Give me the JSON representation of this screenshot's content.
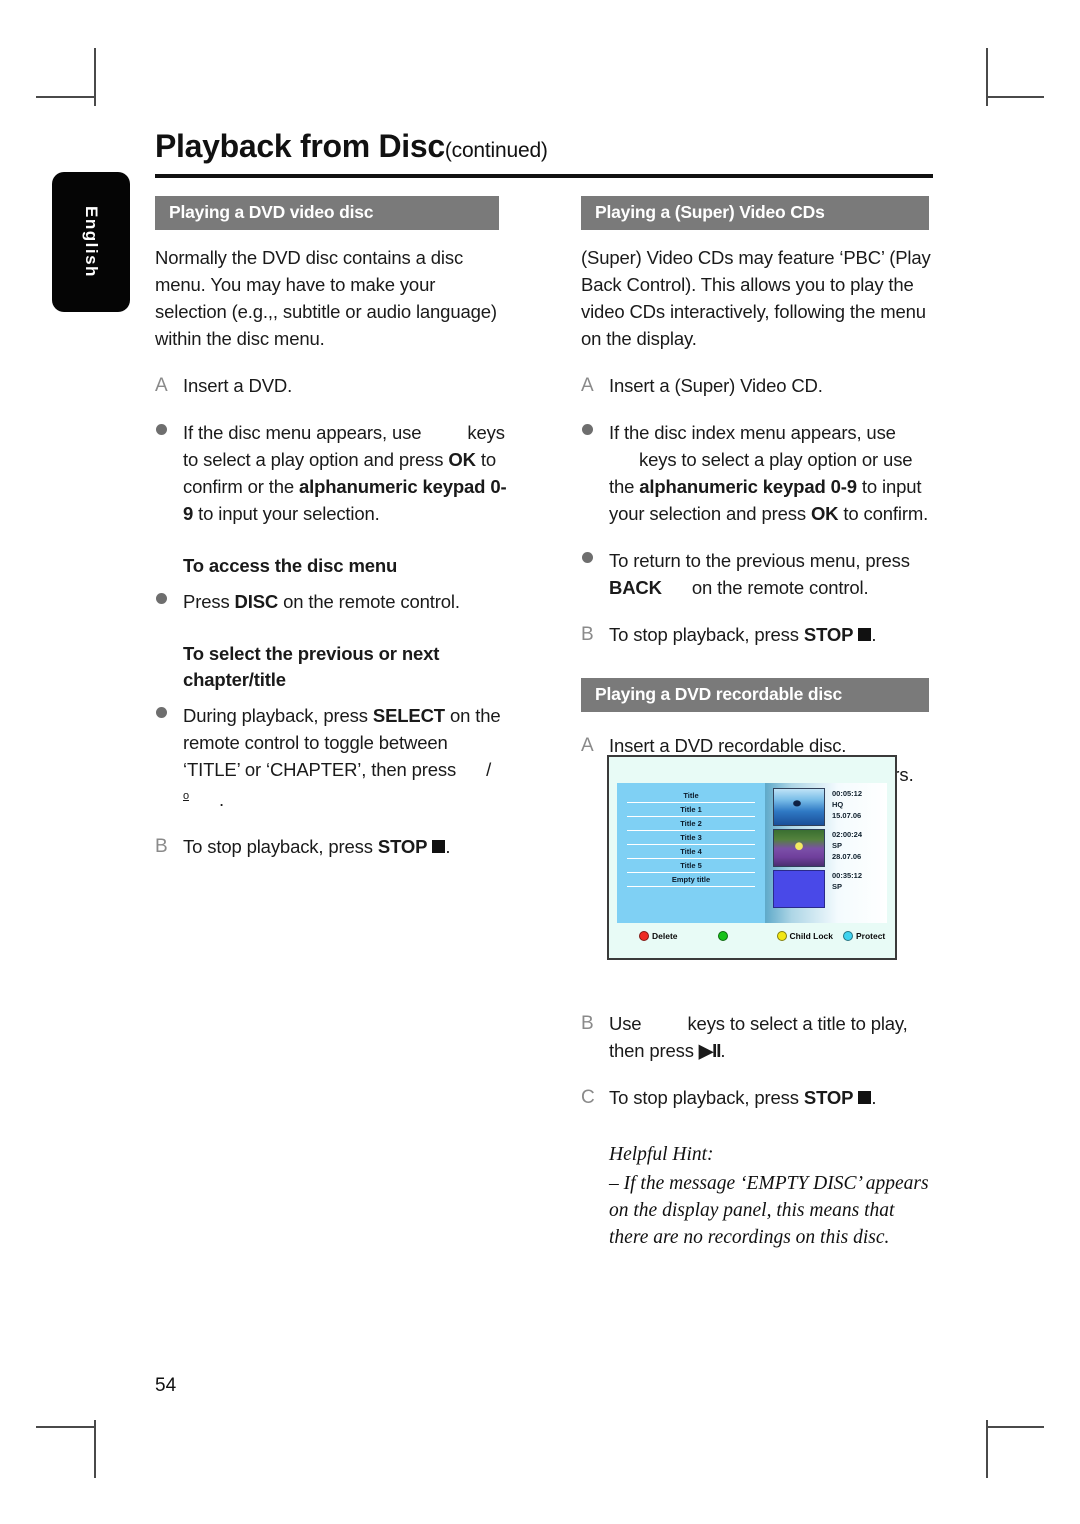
{
  "page": {
    "language_tab": "English",
    "title_main": "Playback from Disc",
    "title_continued": "(continued)",
    "page_number": "54"
  },
  "left_column": {
    "section_title": "Playing a DVD video disc",
    "intro": "Normally the DVD disc contains a disc menu. You may have to make your selection (e.g.,, subtitle or audio language) within the disc menu.",
    "step_a_marker": "A",
    "step_a_text": "Insert a DVD.",
    "bullet1_pre": "If the disc menu appears, use",
    "bullet1_mid": "keys to select a play option and press",
    "bullet1_ok": "OK",
    "bullet1_post": "to confirm or the",
    "bullet1_keypad": "alphanumeric keypad 0-9",
    "bullet1_end": "to input your selection.",
    "subhead1": "To access the disc menu",
    "bullet2_pre": "Press",
    "bullet2_disc": "DISC",
    "bullet2_post": "on the remote control.",
    "subhead2": "To select the previous or next chapter/title",
    "bullet3_pre": "During playback, press",
    "bullet3_select": "SELECT",
    "bullet3_post": "on the remote control to toggle between ‘TITLE’ or ‘CHAPTER’, then press",
    "bullet3_slash": "/",
    "bullet3_ordinal": "o",
    "bullet3_end": ".",
    "step_b_marker": "B",
    "step_b_pre": "To stop playback, press",
    "step_b_stop": "STOP",
    "step_b_post": "."
  },
  "right_column": {
    "section_title": "Playing a (Super) Video CDs",
    "intro": "(Super) Video CDs may feature ‘PBC’ (Play Back Control). This allows you to play the video CDs interactively, following the menu on the display.",
    "step_a_marker": "A",
    "step_a_text": "Insert a (Super) Video CD.",
    "bullet1_pre": "If the disc index menu appears, use",
    "bullet1_mid": "keys to select a play option or use the",
    "bullet1_keypad": "alphanumeric keypad 0-9",
    "bullet1_post": "to input your selection and press",
    "bullet1_ok": "OK",
    "bullet1_end": "to confirm.",
    "bullet2_pre": "To return to the previous menu, press",
    "bullet2_back": "BACK",
    "bullet2_post": "on the remote control.",
    "step_b_marker": "B",
    "step_b_pre": "To stop playback, press",
    "step_b_stop": "STOP",
    "step_b_post": ".",
    "section2_title": "Playing a DVD recordable disc",
    "step2_a_marker": "A",
    "step2_a_text": "Insert a DVD recordable disc.",
    "step2_a_sub": "The Index Picture screen appears.",
    "step2_b_marker": "B",
    "step2_b_pre": "Use",
    "step2_b_mid": "keys to select a title to play, then press",
    "step2_b_icon": "▶II",
    "step2_b_post": ".",
    "step2_c_marker": "C",
    "step2_c_pre": "To stop playback, press",
    "step2_c_stop": "STOP",
    "step2_c_post": ".",
    "hint_title": "Helpful Hint:",
    "hint_text": "– If the message ‘EMPTY DISC’ appears on the display panel, this means that there are no recordings on this disc."
  },
  "index_screen": {
    "titles": [
      "Title",
      "Title 1",
      "Title 2",
      "Title 3",
      "Title 4",
      "Title 5",
      "Empty title"
    ],
    "entries": [
      {
        "time": "00:05:12",
        "mode": "HQ",
        "date": "15.07.06",
        "thumb": "surf-thumbnail"
      },
      {
        "time": "02:00:24",
        "mode": "SP",
        "date": "28.07.06",
        "thumb": "flower-thumbnail"
      },
      {
        "time": "00:35:12",
        "mode": "SP",
        "date": "",
        "thumb": "blank-blue-thumbnail"
      }
    ],
    "buttons": [
      {
        "label": "Delete",
        "color": "#ee2b24"
      },
      {
        "label": "",
        "color": "#16c21a"
      },
      {
        "label": "Child Lock",
        "color": "#f2e713"
      },
      {
        "label": "Protect",
        "color": "#3fd3ef"
      }
    ]
  }
}
